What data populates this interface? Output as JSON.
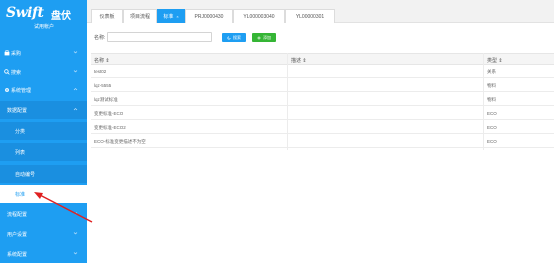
{
  "brand": {
    "logo_word": "Swift",
    "logo_cn": "盘伏",
    "subtitle": "试用帐户"
  },
  "sidebar": {
    "items": [
      {
        "label": "采购",
        "icon": "cart-icon"
      },
      {
        "label": "搜索",
        "icon": "search-icon"
      },
      {
        "label": "系统管理",
        "icon": "gear-icon"
      },
      {
        "label": "数据配置"
      },
      {
        "label": "分类"
      },
      {
        "label": "列表"
      },
      {
        "label": "自动编号"
      },
      {
        "label": "标准"
      },
      {
        "label": "流程配置"
      },
      {
        "label": "用户设置"
      },
      {
        "label": "系统配置"
      }
    ]
  },
  "tabs": [
    {
      "label": "仪表板"
    },
    {
      "label": "项目流程"
    },
    {
      "label": "标准",
      "close": "×"
    },
    {
      "label": "PRJ0000430"
    },
    {
      "label": "YL000003040"
    },
    {
      "label": "YL00000301"
    }
  ],
  "search": {
    "label": "名称:",
    "value": "",
    "search_button": "搜索",
    "add_button": "添加"
  },
  "table": {
    "columns": [
      "名称 ⇕",
      "描述 ⇕",
      "类型 ⇕"
    ],
    "rows": [
      [
        "test02",
        "",
        "关系"
      ],
      [
        "lqz-5555",
        "",
        "物料"
      ],
      [
        "lqz测试标准",
        "",
        "物料"
      ],
      [
        "变更标准-ECO",
        "",
        "ECO"
      ],
      [
        "变更标准-ECO2",
        "",
        "ECO"
      ],
      [
        "ECO-标准变更描述不为空",
        "",
        "ECO"
      ]
    ]
  },
  "colors": {
    "sidebar": "#1e9ef2",
    "search_button": "#1e9ef2",
    "add_button": "#35b535",
    "annotation_arrow": "#e02020"
  }
}
